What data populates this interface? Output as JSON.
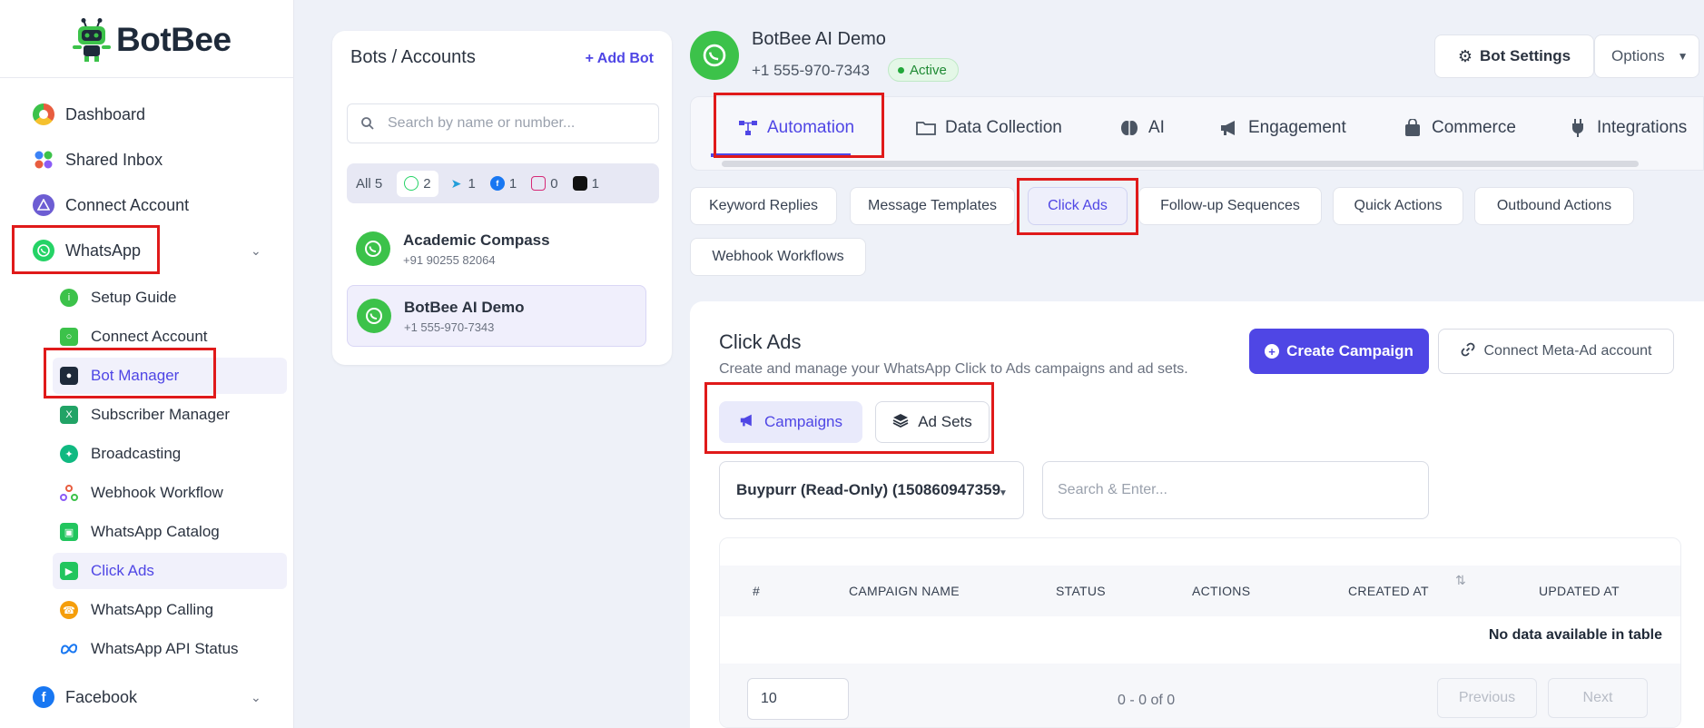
{
  "sidebar": {
    "brand": "BotBee",
    "top_items": [
      {
        "label": "Dashboard",
        "color": "#e85d3f"
      },
      {
        "label": "Shared Inbox",
        "color": "#3b82f6"
      },
      {
        "label": "Connect Account",
        "color": "#6d5dd3"
      },
      {
        "label": "WhatsApp",
        "color": "#25d366"
      }
    ],
    "whatsapp_sub": [
      {
        "label": "Setup Guide"
      },
      {
        "label": "Connect Account"
      },
      {
        "label": "Bot Manager"
      },
      {
        "label": "Subscriber Manager"
      },
      {
        "label": "Broadcasting"
      },
      {
        "label": "Webhook Workflow"
      },
      {
        "label": "WhatsApp Catalog"
      },
      {
        "label": "Click Ads"
      },
      {
        "label": "WhatsApp Calling"
      },
      {
        "label": "WhatsApp API Status"
      }
    ],
    "bottom_items": [
      {
        "label": "Facebook",
        "color": "#1877f2"
      }
    ]
  },
  "bots": {
    "title": "Bots / Accounts",
    "add_label": "Add Bot",
    "search_placeholder": "Search by name or number...",
    "filters": {
      "all": "All 5",
      "whatsapp": "2",
      "telegram": "1",
      "facebook": "1",
      "instagram": "0",
      "other": "1"
    },
    "list": [
      {
        "name": "Academic Compass",
        "number": "+91 90255 82064"
      },
      {
        "name": "BotBee AI Demo",
        "number": "+1 555-970-7343"
      }
    ]
  },
  "header": {
    "bot_name": "BotBee AI Demo",
    "phone": "+1 555-970-7343",
    "status": "Active",
    "settings_label": "Bot Settings",
    "options_label": "Options"
  },
  "main_tabs": [
    "Automation",
    "Data Collection",
    "AI",
    "Engagement",
    "Commerce",
    "Integrations"
  ],
  "sub_tabs": [
    "Keyword Replies",
    "Message Templates",
    "Click Ads",
    "Follow-up Sequences",
    "Quick Actions",
    "Outbound Actions",
    "Webhook Workflows"
  ],
  "click_ads": {
    "title": "Click Ads",
    "description": "Create and manage your WhatsApp Click to Ads campaigns and ad sets.",
    "create_label": "Create Campaign",
    "connect_label": "Connect Meta-Ad account",
    "seg_campaigns": "Campaigns",
    "seg_adsets": "Ad Sets",
    "account_select": "Buypurr (Read-Only) (150860947359",
    "search_placeholder": "Search & Enter...",
    "columns": [
      "#",
      "CAMPAIGN NAME",
      "STATUS",
      "ACTIONS",
      "CREATED AT",
      "UPDATED AT"
    ],
    "empty_text": "No data available in table",
    "page_size": "10",
    "range_text": "0 - 0 of 0",
    "prev_label": "Previous",
    "next_label": "Next"
  },
  "colors": {
    "accent": "#4f46e5",
    "whatsapp": "#3cc24a",
    "highlight": "#e01a1a"
  }
}
